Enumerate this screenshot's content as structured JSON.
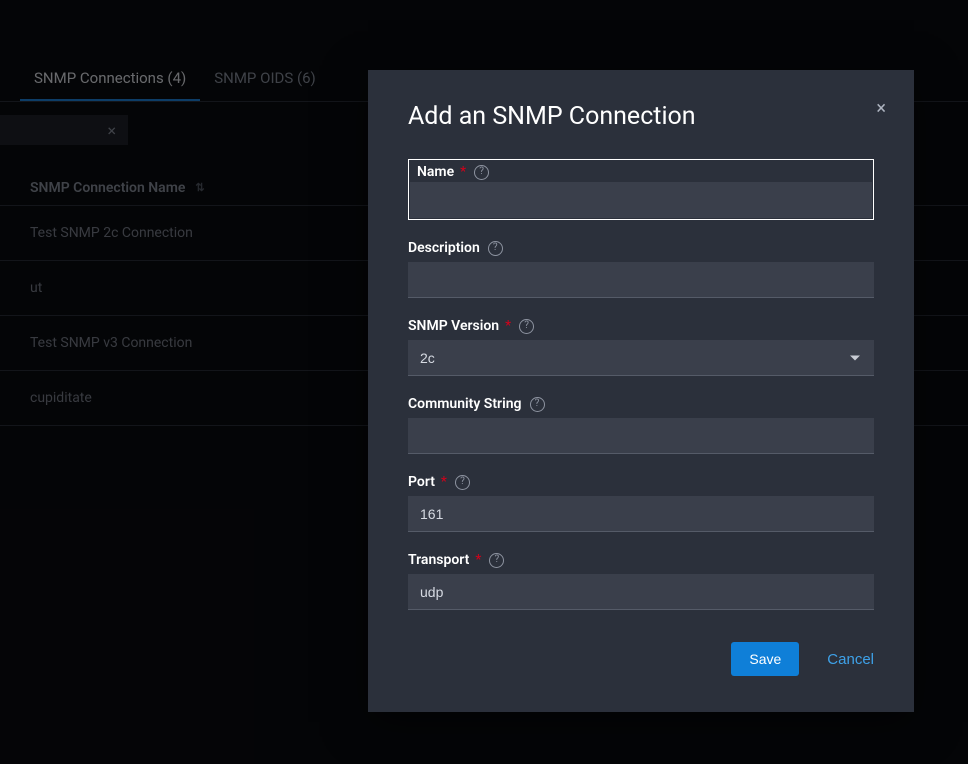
{
  "tabs": [
    {
      "label": "SNMP Connections (4)",
      "active": true
    },
    {
      "label": "SNMP OIDS (6)",
      "active": false
    }
  ],
  "filter_close": "×",
  "table": {
    "header": "SNMP Connection Name",
    "rows": [
      "Test SNMP 2c Connection",
      "ut",
      "Test SNMP v3 Connection",
      "cupiditate"
    ]
  },
  "dialog": {
    "title": "Add an SNMP Connection",
    "close": "×",
    "fields": {
      "name": {
        "label": "Name",
        "required": "*",
        "value": ""
      },
      "description": {
        "label": "Description",
        "value": ""
      },
      "version": {
        "label": "SNMP Version",
        "required": "*",
        "value": "2c"
      },
      "community": {
        "label": "Community String",
        "value": ""
      },
      "port": {
        "label": "Port",
        "required": "*",
        "value": "161"
      },
      "transport": {
        "label": "Transport",
        "required": "*",
        "value": "udp"
      }
    },
    "actions": {
      "save": "Save",
      "cancel": "Cancel"
    }
  }
}
